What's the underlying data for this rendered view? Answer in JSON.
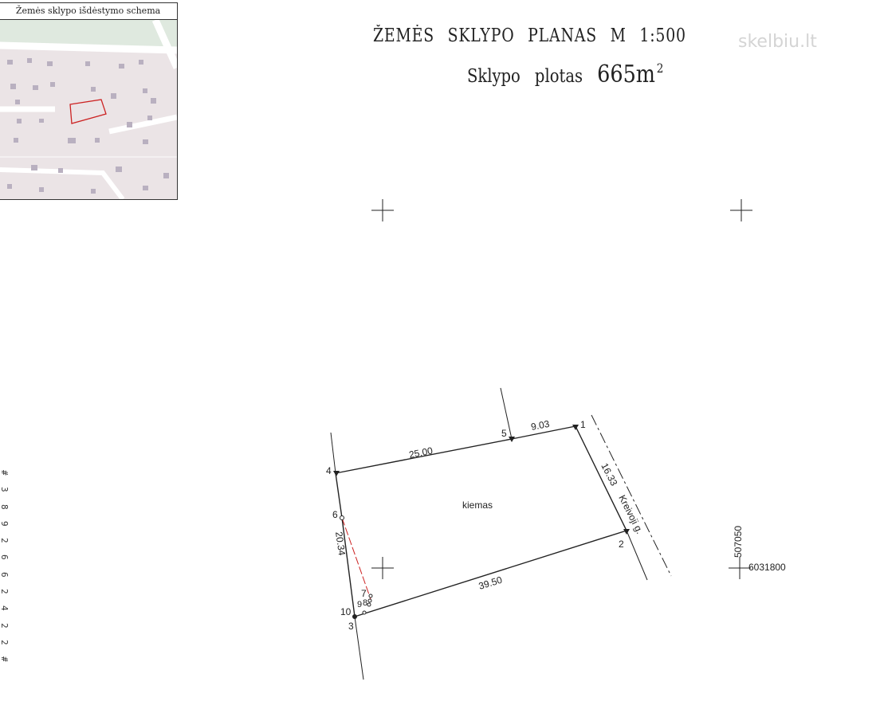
{
  "inset": {
    "title": "Žemės sklypo išdėstymo schema"
  },
  "header": {
    "title_words": [
      "ŽEMĖS",
      "SKLYPO",
      "PLANAS",
      "M",
      "1:500"
    ],
    "area_prefix": "Sklypo plotas",
    "area_value": "665m",
    "area_exponent": "2",
    "watermark": "skelbiu.lt"
  },
  "plan": {
    "scale": "1:500",
    "parcel_area_m2": 665,
    "yard_label": "kiemas",
    "street_label": "Kreivoji g.",
    "points": [
      "1",
      "2",
      "3",
      "4",
      "5",
      "6",
      "7",
      "8",
      "9",
      "10"
    ],
    "distances": {
      "d45": "25.00",
      "d51": "9.03",
      "d12": "16.33",
      "d23": "39.50",
      "d43": "20.34"
    },
    "grid": {
      "x_label": "507050",
      "y_label": "6031800"
    }
  },
  "edge_marks": [
    "#",
    "3",
    "8",
    "9",
    "2",
    "6",
    "6",
    "2",
    "4",
    "2",
    "2",
    "#"
  ],
  "colors": {
    "ink": "#222222",
    "parcel_red": "#cc2222",
    "inset_bg": "#ebe4e6",
    "inset_road": "#ffffff",
    "inset_green": "#dfe9df",
    "inset_building": "#b9b0c0",
    "watermark": "#d4d4d4"
  }
}
